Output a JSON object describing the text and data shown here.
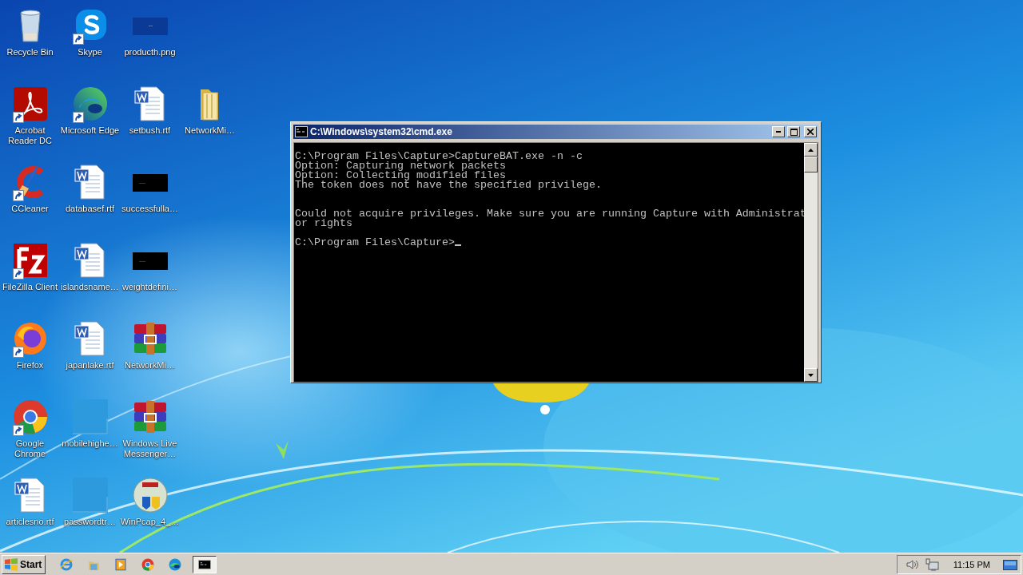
{
  "desktop": {
    "rows": [
      [
        {
          "label": "Recycle Bin",
          "kind": "recycle-bin",
          "shortcut": false
        },
        {
          "label": "Skype",
          "kind": "skype",
          "shortcut": true
        },
        {
          "label": "producth.png",
          "kind": "dark-thumbnail",
          "shortcut": false
        }
      ],
      [
        {
          "label": "Acrobat Reader DC",
          "kind": "acrobat",
          "shortcut": true
        },
        {
          "label": "Microsoft Edge",
          "kind": "edge",
          "shortcut": true
        },
        {
          "label": "setbush.rtf",
          "kind": "word",
          "shortcut": false
        },
        {
          "label": "NetworkMi…",
          "kind": "folder",
          "shortcut": false
        }
      ],
      [
        {
          "label": "CCleaner",
          "kind": "ccleaner",
          "shortcut": true
        },
        {
          "label": "databasef.rtf",
          "kind": "word",
          "shortcut": false
        },
        {
          "label": "successfulla…",
          "kind": "black-thumbnail",
          "shortcut": false
        }
      ],
      [
        {
          "label": "FileZilla Client",
          "kind": "filezilla",
          "shortcut": true
        },
        {
          "label": "islandsname…",
          "kind": "word",
          "shortcut": false
        },
        {
          "label": "weightdefini…",
          "kind": "black-thumbnail",
          "shortcut": false
        }
      ],
      [
        {
          "label": "Firefox",
          "kind": "firefox",
          "shortcut": true
        },
        {
          "label": "japanlake.rtf",
          "kind": "word",
          "shortcut": false
        },
        {
          "label": "NetworkMi…",
          "kind": "winrar",
          "shortcut": false
        }
      ],
      [
        {
          "label": "Google Chrome",
          "kind": "chrome",
          "shortcut": true
        },
        {
          "label": "mobilehighe…",
          "kind": "blank-thumbnail",
          "shortcut": false
        },
        {
          "label": "Windows Live Messenger…",
          "kind": "winrar",
          "shortcut": false
        }
      ],
      [
        {
          "label": "articlesno.rtf",
          "kind": "word",
          "shortcut": false
        },
        {
          "label": "passwordtr…",
          "kind": "blank-thumbnail",
          "shortcut": false
        },
        {
          "label": "WinPcap_4_…",
          "kind": "winpcap",
          "shortcut": false
        }
      ]
    ]
  },
  "console_window": {
    "title": "C:\\Windows\\system32\\cmd.exe",
    "blocks": [
      [
        "C:\\Program Files\\Capture>CaptureBAT.exe -n -c",
        "Option: Capturing network packets",
        "Option: Collecting modified files",
        "The token does not have the specified privilege."
      ],
      [
        "Could not acquire privileges. Make sure you are running Capture with Administrat",
        "or rights"
      ],
      [
        "C:\\Program Files\\Capture>"
      ]
    ]
  },
  "taskbar": {
    "start_label": "Start",
    "items": [
      {
        "kind": "ie",
        "active": false
      },
      {
        "kind": "explorer",
        "active": false
      },
      {
        "kind": "media",
        "active": false
      },
      {
        "kind": "chrome",
        "active": false
      },
      {
        "kind": "edge",
        "active": false
      },
      {
        "kind": "console",
        "active": true
      }
    ],
    "clock": "11:15 PM"
  }
}
